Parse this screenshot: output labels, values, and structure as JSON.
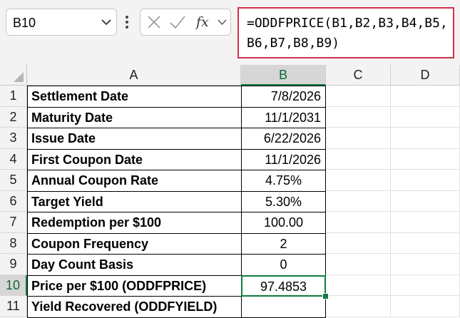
{
  "name_box": {
    "value": "B10"
  },
  "formula_bar": {
    "fx_label": "fx",
    "formula": "=ODDFPRICE(B1,B2,B3,B4,B5,B6,B7,B8,B9)"
  },
  "columns": [
    "A",
    "B",
    "C",
    "D"
  ],
  "selected_column": "B",
  "selected_row": "10",
  "rows": [
    {
      "num": "1",
      "label": "Settlement Date",
      "value": "7/8/2026",
      "align": "right"
    },
    {
      "num": "2",
      "label": "Maturity Date",
      "value": "11/1/2031",
      "align": "right"
    },
    {
      "num": "3",
      "label": "Issue Date",
      "value": "6/22/2026",
      "align": "right"
    },
    {
      "num": "4",
      "label": "First Coupon Date",
      "value": "11/1/2026",
      "align": "right"
    },
    {
      "num": "5",
      "label": "Annual Coupon Rate",
      "value": "4.75%",
      "align": "center"
    },
    {
      "num": "6",
      "label": "Target Yield",
      "value": "5.30%",
      "align": "center"
    },
    {
      "num": "7",
      "label": "Redemption per $100",
      "value": "100.00",
      "align": "center"
    },
    {
      "num": "8",
      "label": "Coupon Frequency",
      "value": "2",
      "align": "center"
    },
    {
      "num": "9",
      "label": "Day Count Basis",
      "value": "0",
      "align": "center"
    },
    {
      "num": "10",
      "label": "Price per $100 (ODDFPRICE)",
      "value": "97.4853",
      "align": "center"
    },
    {
      "num": "11",
      "label": "Yield Recovered (ODDFYIELD)",
      "value": "",
      "align": "center"
    }
  ],
  "colors": {
    "accent_green": "#107c41",
    "formula_border": "#d32f4a"
  }
}
